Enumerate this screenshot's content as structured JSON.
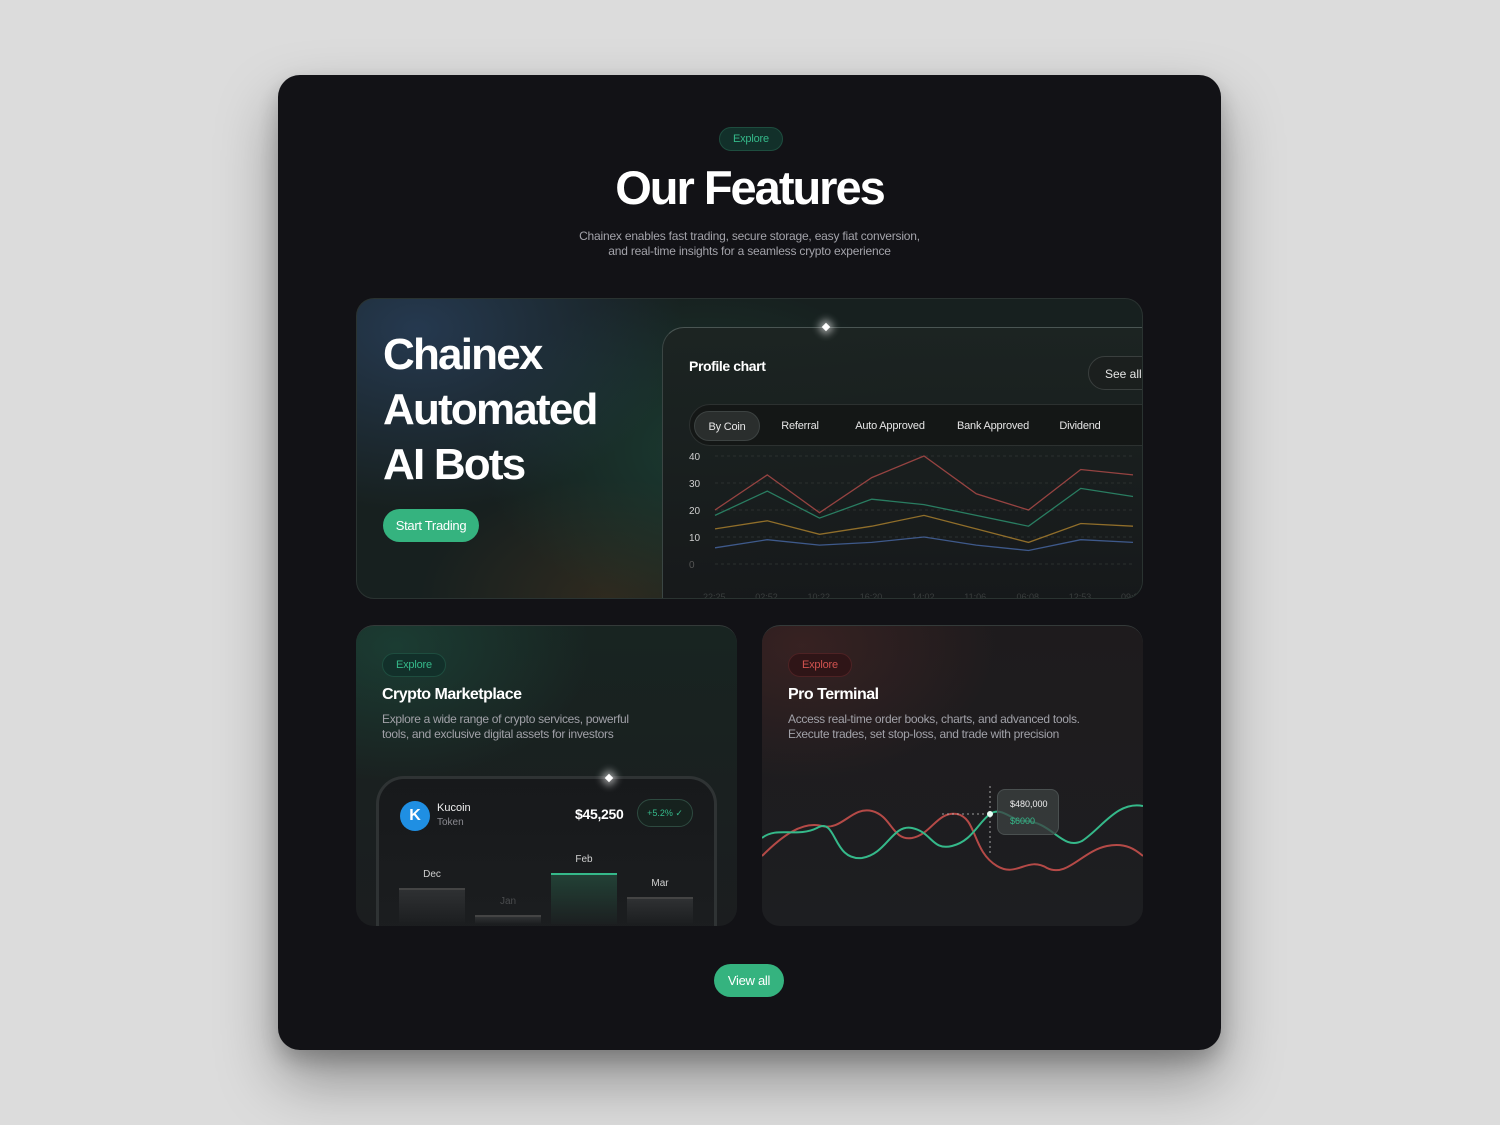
{
  "section": {
    "badge": "Explore",
    "title": "Our Features",
    "subtitle_lines": [
      "Chainex enables fast trading, secure storage, easy fiat conversion,",
      "and real-time insights for a seamless crypto experience"
    ]
  },
  "hero": {
    "title_lines": [
      "Chainex",
      "Automated",
      "AI Bots"
    ],
    "cta_label": "Start Trading",
    "profile_chart": {
      "title": "Profile chart",
      "see_all": "See all",
      "tabs": [
        "By Coin",
        "Referral",
        "Auto Approved",
        "Bank Approved",
        "Dividend"
      ],
      "active_tab": "By Coin",
      "y_ticks": [
        "40",
        "30",
        "20",
        "10",
        "0"
      ],
      "x_ticks": [
        "22:25",
        "02:52",
        "10:22",
        "16:20",
        "14:02",
        "11:06",
        "06:08",
        "12:53",
        "09:21"
      ]
    }
  },
  "chart_data": [
    {
      "type": "line",
      "title": "Profile chart",
      "ylim": [
        0,
        40
      ],
      "x": [
        "22:25",
        "02:52",
        "10:22",
        "16:20",
        "14:02",
        "11:06",
        "06:08",
        "12:53",
        "09:21"
      ],
      "series": [
        {
          "color": "#c0504d",
          "values": [
            20,
            33,
            19,
            32,
            40,
            26,
            20,
            35,
            33
          ]
        },
        {
          "color": "#2f9e78",
          "values": [
            18,
            27,
            17,
            24,
            22,
            18,
            14,
            28,
            25
          ]
        },
        {
          "color": "#b8892f",
          "values": [
            13,
            16,
            11,
            14,
            18,
            13,
            8,
            15,
            14
          ]
        },
        {
          "color": "#4c6fb0",
          "values": [
            6,
            9,
            7,
            8,
            10,
            7,
            5,
            9,
            8
          ]
        }
      ]
    },
    {
      "type": "bar",
      "categories": [
        "Dec",
        "Jan",
        "Feb",
        "Mar"
      ],
      "values": [
        60,
        15,
        85,
        45
      ]
    }
  ],
  "marketplace": {
    "badge": "Explore",
    "title": "Crypto Marketplace",
    "desc_lines": [
      "Explore a wide range of crypto services, powerful",
      "tools, and exclusive digital assets for investors"
    ],
    "coin_name": "Kucoin",
    "coin_sub": "Token",
    "price": "$45,250",
    "change": "+5.2%",
    "accent": "#35b98a"
  },
  "terminal": {
    "badge": "Explore",
    "title": "Pro Terminal",
    "desc_lines": [
      "Access real-time order books, charts, and advanced tools.",
      "Execute trades, set stop-loss, and trade with precision"
    ],
    "tooltip_value": "$480,000",
    "tooltip_change": "$6000",
    "up_color": "#35b98a",
    "down_color": "#d0524f"
  },
  "footer": {
    "view_all": "View all"
  }
}
